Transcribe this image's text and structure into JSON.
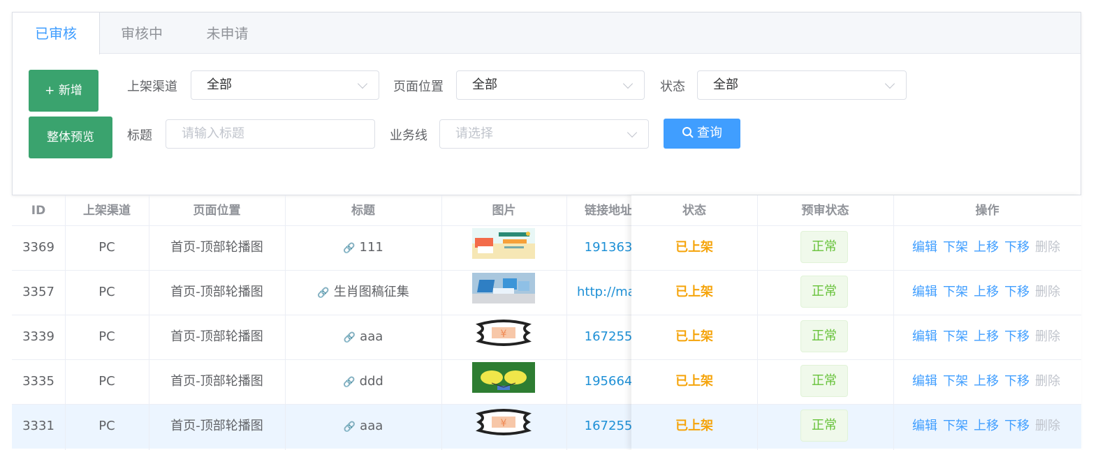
{
  "tabs": [
    "已审核",
    "审核中",
    "未申请"
  ],
  "buttons": {
    "add": "+ 新增",
    "preview": "整体预览",
    "search": "查询"
  },
  "filters": {
    "channel_label": "上架渠道",
    "channel_value": "全部",
    "position_label": "页面位置",
    "position_value": "全部",
    "status_label": "状态",
    "status_value": "全部",
    "title_label": "标题",
    "title_placeholder": "请输入标题",
    "business_label": "业务线",
    "business_placeholder": "请选择"
  },
  "table": {
    "headers": [
      "ID",
      "上架渠道",
      "页面位置",
      "标题",
      "图片",
      "链接地址",
      "状态",
      "预审状态",
      "操作"
    ],
    "actions": [
      "编辑",
      "下架",
      "上移",
      "下移",
      "删除"
    ],
    "rows": [
      {
        "id": "3369",
        "channel": "PC",
        "position": "首页-顶部轮播图",
        "title": "111",
        "link": "191363",
        "status": "已上架",
        "review": "正常"
      },
      {
        "id": "3357",
        "channel": "PC",
        "position": "首页-顶部轮播图",
        "title": "生肖图稿征集",
        "link": "http://mall",
        "status": "已上架",
        "review": "正常"
      },
      {
        "id": "3339",
        "channel": "PC",
        "position": "首页-顶部轮播图",
        "title": "aaa",
        "link": "167255",
        "status": "已上架",
        "review": "正常"
      },
      {
        "id": "3335",
        "channel": "PC",
        "position": "首页-顶部轮播图",
        "title": "ddd",
        "link": "195664",
        "status": "已上架",
        "review": "正常"
      },
      {
        "id": "3331",
        "channel": "PC",
        "position": "首页-顶部轮播图",
        "title": "aaa",
        "link": "167255",
        "status": "已上架",
        "review": "正常"
      }
    ]
  }
}
